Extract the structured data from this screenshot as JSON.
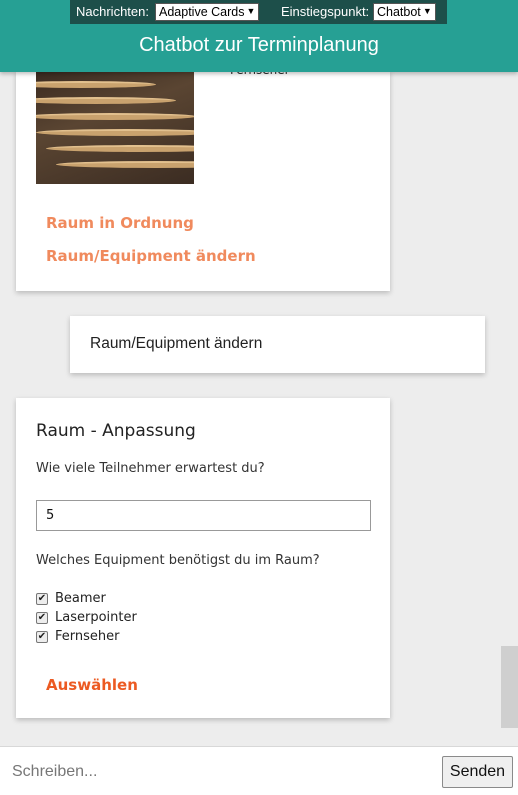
{
  "header": {
    "title": "Chatbot zur Terminplanung",
    "messages_label": "Nachrichten:",
    "messages_value": "Adaptive Cards",
    "entry_label": "Einstiegspunkt:",
    "entry_value": "Chatbot"
  },
  "room_card": {
    "image_icon": "conference-room-photo",
    "cut_off_text": "Fernseher",
    "actions": [
      "Raum in Ordnung",
      "Raum/Equipment ändern"
    ]
  },
  "user_message": {
    "text": "Raum/Equipment ändern"
  },
  "adjust_card": {
    "title": "Raum - Anpassung",
    "question_participants": "Wie viele Teilnehmer erwartest du?",
    "participants_value": "5",
    "question_equipment": "Welches Equipment benötigst du im Raum?",
    "equipment": [
      {
        "label": "Beamer",
        "checked": true
      },
      {
        "label": "Laserpointer",
        "checked": true
      },
      {
        "label": "Fernseher",
        "checked": true
      }
    ],
    "submit_label": "Auswählen"
  },
  "composer": {
    "placeholder": "Schreiben...",
    "send_label": "Senden"
  },
  "colors": {
    "header": "#26a094",
    "header_controls": "#1d4f4a",
    "action": "#f08a5d",
    "action_strong": "#ec5a22"
  }
}
